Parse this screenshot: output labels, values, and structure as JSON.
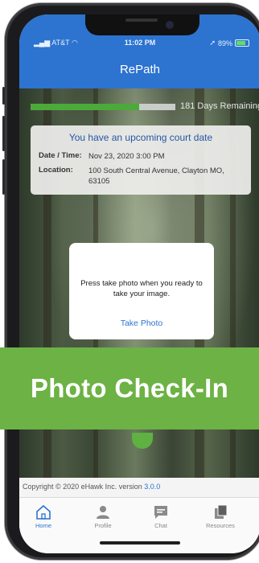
{
  "status_bar": {
    "carrier": "AT&T",
    "time": "11:02 PM",
    "battery": "89%"
  },
  "app": {
    "title": "RePath"
  },
  "progress": {
    "fraction": 0.75,
    "text": "181 Days Remaining"
  },
  "court_card": {
    "title": "You have an upcoming court date",
    "date_label": "Date / Time:",
    "date_value": "Nov 23, 2020 3:00 PM",
    "location_label": "Location:",
    "location_value": "100 South Central Avenue, Clayton MO, 63105"
  },
  "dialog": {
    "message": "Press take photo when you ready to take your image.",
    "action_label": "Take Photo"
  },
  "banner": {
    "text": "Photo Check-In"
  },
  "footer": {
    "copyright": "Copyright © 2020 eHawk Inc. version ",
    "version": "3.0.0"
  },
  "tabs": [
    {
      "label": "Home",
      "icon": "home-icon",
      "active": true
    },
    {
      "label": "Profile",
      "icon": "profile-icon",
      "active": false
    },
    {
      "label": "Chat",
      "icon": "chat-icon",
      "active": false
    },
    {
      "label": "Resources",
      "icon": "resources-icon",
      "active": false
    }
  ],
  "colors": {
    "primary": "#2d73d0",
    "progress": "#4caa3a",
    "banner": "#6cb244"
  }
}
